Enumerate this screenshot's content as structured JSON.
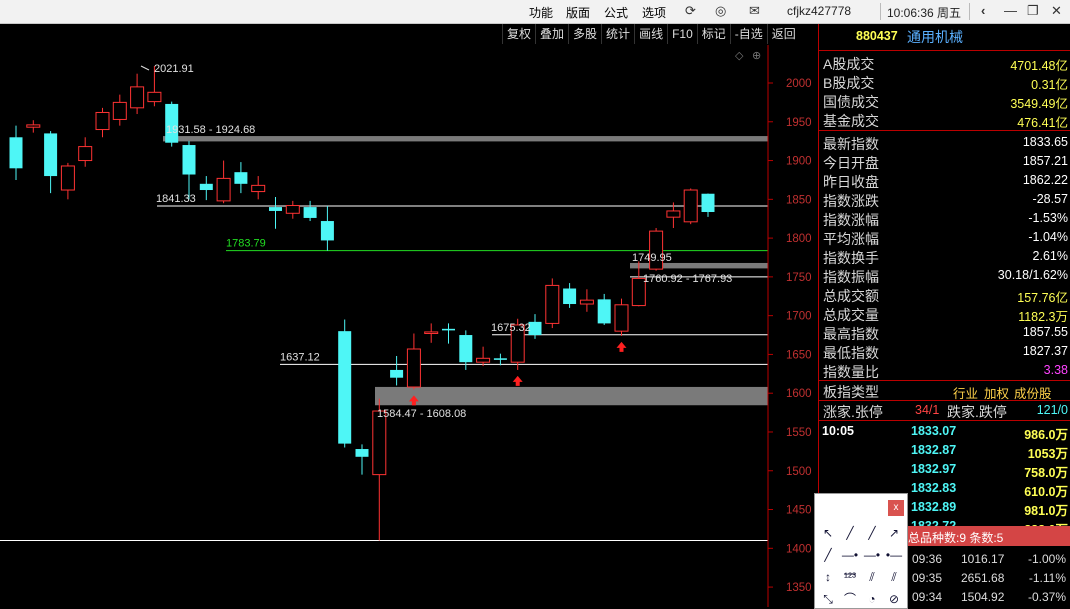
{
  "app": {
    "menus": [
      "功能",
      "版面",
      "公式",
      "选项"
    ],
    "account": "cfjkz427778",
    "clock": "10:06:36 周五"
  },
  "toolbar": [
    "复权",
    "叠加",
    "多股",
    "统计",
    "画线",
    "F10",
    "标记",
    "-自选",
    "返回"
  ],
  "chart_data": {
    "type": "candlestick",
    "ylim": [
      1350,
      2050
    ],
    "y_ticks": [
      2000,
      1950,
      1900,
      1850,
      1800,
      1750,
      1700,
      1650,
      1600,
      1550,
      1500,
      1450,
      1400,
      1350
    ],
    "candles": [
      {
        "o": 1930,
        "c": 1890,
        "h": 1945,
        "l": 1875
      },
      {
        "o": 1943,
        "c": 1946,
        "h": 1952,
        "l": 1936
      },
      {
        "o": 1935,
        "c": 1880,
        "h": 1938,
        "l": 1858
      },
      {
        "o": 1862,
        "c": 1893,
        "h": 1897,
        "l": 1850
      },
      {
        "o": 1900,
        "c": 1918,
        "h": 1930,
        "l": 1892
      },
      {
        "o": 1940,
        "c": 1962,
        "h": 1968,
        "l": 1930
      },
      {
        "o": 1953,
        "c": 1975,
        "h": 1985,
        "l": 1945
      },
      {
        "o": 1968,
        "c": 1995,
        "h": 2012,
        "l": 1960
      },
      {
        "o": 1976,
        "c": 1988,
        "h": 2021.91,
        "l": 1970
      },
      {
        "o": 1973,
        "c": 1923,
        "h": 1976,
        "l": 1918
      },
      {
        "o": 1920,
        "c": 1882,
        "h": 1925,
        "l": 1850
      },
      {
        "o": 1870,
        "c": 1862,
        "h": 1880,
        "l": 1849
      },
      {
        "o": 1848,
        "c": 1877,
        "h": 1900,
        "l": 1845
      },
      {
        "o": 1885,
        "c": 1870,
        "h": 1898,
        "l": 1858
      },
      {
        "o": 1860,
        "c": 1868,
        "h": 1880,
        "l": 1850
      },
      {
        "o": 1840,
        "c": 1835,
        "h": 1853,
        "l": 1812
      },
      {
        "o": 1832,
        "c": 1842,
        "h": 1848,
        "l": 1825
      },
      {
        "o": 1840,
        "c": 1826,
        "h": 1848,
        "l": 1822
      },
      {
        "o": 1822,
        "c": 1797,
        "h": 1841.33,
        "l": 1783.79
      },
      {
        "o": 1680,
        "c": 1535,
        "h": 1695,
        "l": 1530
      },
      {
        "o": 1528,
        "c": 1518,
        "h": 1534,
        "l": 1495
      },
      {
        "o": 1495,
        "c": 1577,
        "h": 1593,
        "l": 1410
      },
      {
        "o": 1630,
        "c": 1620,
        "h": 1648,
        "l": 1610
      },
      {
        "o": 1608,
        "c": 1657,
        "h": 1677,
        "l": 1605
      },
      {
        "o": 1677,
        "c": 1679,
        "h": 1690,
        "l": 1665
      },
      {
        "o": 1683,
        "c": 1681,
        "h": 1690,
        "l": 1664
      },
      {
        "o": 1675,
        "c": 1640,
        "h": 1681,
        "l": 1630
      },
      {
        "o": 1640,
        "c": 1645,
        "h": 1660,
        "l": 1635
      },
      {
        "o": 1645,
        "c": 1643,
        "h": 1651,
        "l": 1636
      },
      {
        "o": 1640,
        "c": 1688,
        "h": 1696,
        "l": 1630
      },
      {
        "o": 1692,
        "c": 1675,
        "h": 1702,
        "l": 1670
      },
      {
        "o": 1690,
        "c": 1739,
        "h": 1748,
        "l": 1684
      },
      {
        "o": 1735,
        "c": 1715,
        "h": 1742,
        "l": 1710
      },
      {
        "o": 1715,
        "c": 1720,
        "h": 1734,
        "l": 1705
      },
      {
        "o": 1721,
        "c": 1690,
        "h": 1728,
        "l": 1688
      },
      {
        "o": 1680,
        "c": 1714,
        "h": 1722,
        "l": 1674
      },
      {
        "o": 1713,
        "c": 1748,
        "h": 1770,
        "l": 1712
      },
      {
        "o": 1760,
        "c": 1809,
        "h": 1813,
        "l": 1758
      },
      {
        "o": 1827,
        "c": 1835,
        "h": 1846,
        "l": 1813
      },
      {
        "o": 1821,
        "c": 1862,
        "h": 1864,
        "l": 1818
      },
      {
        "o": 1857.21,
        "c": 1833.65,
        "h": 1857.55,
        "l": 1827.37
      }
    ],
    "annotations": {
      "high": "2021.91",
      "gap1": "1931.58 - 1924.68",
      "p1841": "1841.33",
      "p1783": "1783.79",
      "p1637": "1637.12",
      "p1675": "1675.32",
      "gap2": "1584.47 - 1608.08",
      "p1749": "1749.95",
      "gap3": "1760.92 - 1767.93"
    },
    "levels": {
      "gap1": [
        1924.68,
        1931.58
      ],
      "line1841": 1841.33,
      "line1783": 1783.79,
      "gap3": [
        1760.92,
        1767.93
      ],
      "line1749": 1749.95,
      "line1675": 1675.32,
      "line1637": 1637.12,
      "gap2": [
        1584.47,
        1608.08
      ],
      "line1410": 1410
    },
    "arrows_at_candles": [
      23,
      29,
      35
    ],
    "colors": {
      "up": "#ff3333",
      "down": "#4ef6f6",
      "gap": "#7a7a7a"
    }
  },
  "panel": {
    "code": "880437",
    "name": "通用机械",
    "turnover": [
      {
        "label": "A股成交",
        "value": "4701.48亿"
      },
      {
        "label": "B股成交",
        "value": "0.31亿"
      },
      {
        "label": "国债成交",
        "value": "3549.49亿"
      },
      {
        "label": "基金成交",
        "value": "476.41亿"
      }
    ],
    "stats": [
      {
        "label": "最新指数",
        "value": "1833.65",
        "color": "#ffffff"
      },
      {
        "label": "今日开盘",
        "value": "1857.21",
        "color": "#ffffff"
      },
      {
        "label": "昨日收盘",
        "value": "1862.22",
        "color": "#ffffff"
      },
      {
        "label": "指数涨跌",
        "value": "-28.57",
        "color": "#ffffff"
      },
      {
        "label": "指数涨幅",
        "value": "-1.53%",
        "color": "#ffffff"
      },
      {
        "label": "平均涨幅",
        "value": "-1.04%",
        "color": "#ffffff"
      },
      {
        "label": "指数换手",
        "value": "2.61%",
        "color": "#ffffff"
      },
      {
        "label": "指数振幅",
        "value": "30.18/1.62%",
        "color": "#ffffff"
      },
      {
        "label": "总成交额",
        "value": "157.76亿",
        "color": "#ffff55"
      },
      {
        "label": "总成交量",
        "value": "1182.3万",
        "color": "#ffff55"
      },
      {
        "label": "最高指数",
        "value": "1857.55",
        "color": "#ffffff"
      },
      {
        "label": "最低指数",
        "value": "1827.37",
        "color": "#ffffff"
      },
      {
        "label": "指数量比",
        "value": "3.38",
        "color": "#ff44ff"
      }
    ],
    "type_label": "板指类型",
    "type_values": [
      "行业",
      "加权",
      "成份股"
    ],
    "updown_label1": "涨家.张停",
    "updown_value1": "34/1",
    "updown_label2": "跌家.跌停",
    "updown_value2": "121/0",
    "ticks_time": "10:05",
    "ticks": [
      {
        "price": "1833.07",
        "vol": "986.0万"
      },
      {
        "price": "1832.87",
        "vol": "1053万"
      },
      {
        "price": "1832.97",
        "vol": "758.0万"
      },
      {
        "price": "1832.83",
        "vol": "610.0万"
      },
      {
        "price": "1832.89",
        "vol": "981.0万"
      },
      {
        "price": "1832.72",
        "vol": "888.0万"
      }
    ]
  },
  "popup": {
    "close_glyph": "x",
    "tools": [
      "↖",
      "╱",
      "╱",
      "↗",
      "╱",
      "—•—",
      "—•",
      "•—",
      "↕",
      "¹²³",
      "⫽",
      "⫽",
      "⤡",
      "⌒",
      "◔",
      "⊘"
    ]
  },
  "monitor": {
    "header": "总品种数:9 条数:5",
    "rows": [
      {
        "time": "09:36",
        "val": "1016.17",
        "pct": "-1.00%"
      },
      {
        "time": "09:35",
        "val": "2651.68",
        "pct": "-1.11%"
      },
      {
        "time": "09:34",
        "val": "1504.92",
        "pct": "-0.37%"
      }
    ]
  }
}
